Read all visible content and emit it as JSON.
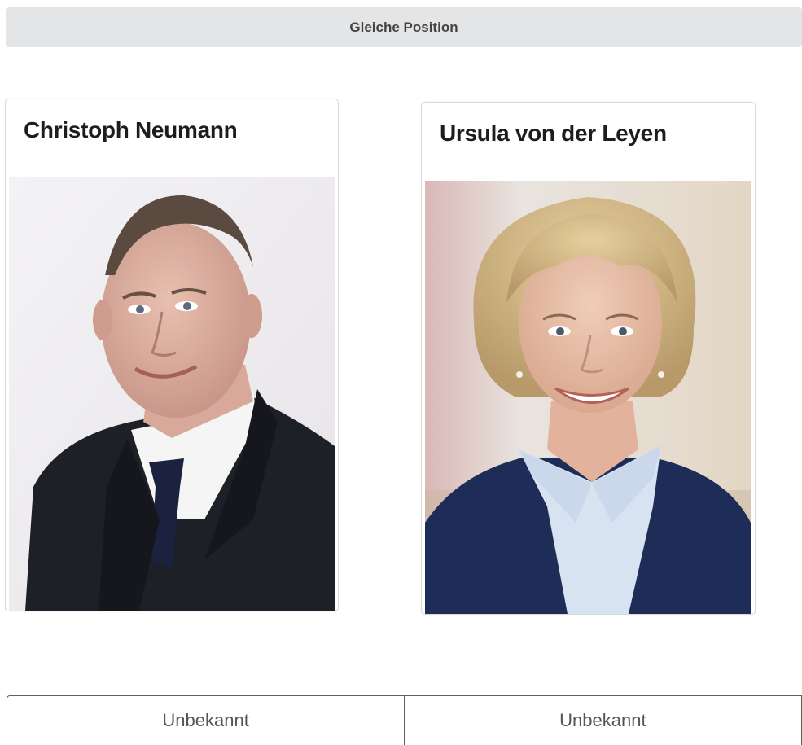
{
  "top_button": {
    "label": "Gleiche Position"
  },
  "candidates": [
    {
      "name": "Christoph Neumann",
      "photo_icon": "portrait-man-photo"
    },
    {
      "name": "Ursula von der Leyen",
      "photo_icon": "portrait-woman-photo"
    }
  ],
  "choices": [
    {
      "label": "Unbekannt"
    },
    {
      "label": "Unbekannt"
    }
  ]
}
